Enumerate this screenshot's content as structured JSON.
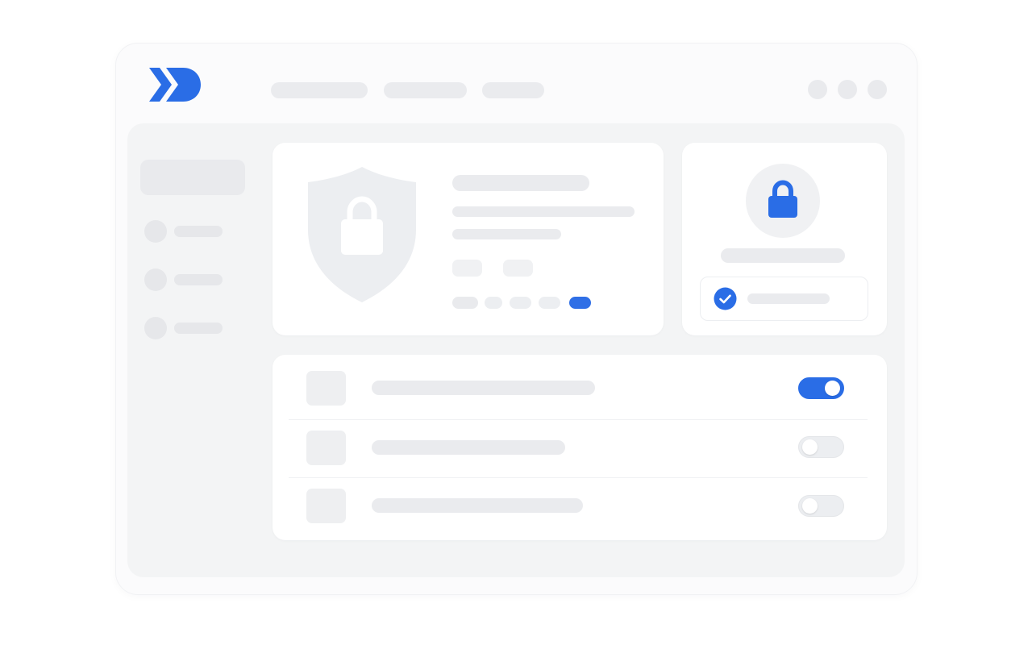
{
  "colors": {
    "accent": "#2a6de6",
    "placeholder": "#eaebee",
    "window_bg": "#fbfbfc",
    "content_bg": "#f3f4f5",
    "card_bg": "#ffffff"
  },
  "header": {
    "logo_icon": "double-chevron-logo",
    "nav_tab_count": 3,
    "window_control_count": 3
  },
  "sidebar": {
    "item_icon": "circle-placeholder",
    "active_index": 0
  },
  "security_card": {
    "icon": "shield-lock-icon",
    "progress_dots": 5,
    "active_step": 5
  },
  "lock_card": {
    "icon": "lock-icon",
    "verified_icon": "check-circle-icon",
    "verified": true
  },
  "settings": {
    "rows": [
      {
        "enabled": true
      },
      {
        "enabled": false
      },
      {
        "enabled": false
      }
    ]
  }
}
